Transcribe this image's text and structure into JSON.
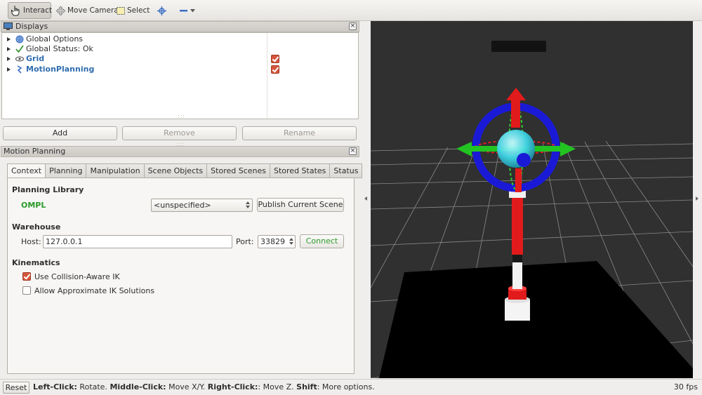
{
  "toolbar": {
    "interact": "Interact",
    "move_camera": "Move Camera",
    "select": "Select"
  },
  "displays": {
    "title": "Displays",
    "items": [
      {
        "label": "Global Options",
        "icon": "globe-icon",
        "checked": null
      },
      {
        "label": "Global Status: Ok",
        "icon": "checkmark-icon",
        "checked": null
      },
      {
        "label": "Grid",
        "icon": "grid-icon",
        "checked": true
      },
      {
        "label": "MotionPlanning",
        "icon": "motion-planning-icon",
        "checked": true
      }
    ],
    "buttons": {
      "add": "Add",
      "remove": "Remove",
      "rename": "Rename"
    }
  },
  "motion_planning": {
    "title": "Motion Planning",
    "tabs": [
      "Context",
      "Planning",
      "Manipulation",
      "Scene Objects",
      "Stored Scenes",
      "Stored States",
      "Status"
    ],
    "selected_tab": "Context",
    "planning_library": {
      "title": "Planning Library",
      "library": "OMPL",
      "planner": "<unspecified>",
      "publish_button": "Publish Current Scene"
    },
    "warehouse": {
      "title": "Warehouse",
      "host_label": "Host:",
      "host": "127.0.0.1",
      "port_label": "Port:",
      "port": "33829",
      "connect_button": "Connect"
    },
    "kinematics": {
      "title": "Kinematics",
      "collision_aware": "Use Collision-Aware IK",
      "collision_aware_checked": true,
      "approximate": "Allow Approximate IK Solutions",
      "approximate_checked": false
    }
  },
  "status": {
    "reset": "Reset",
    "left_click": "Left-Click:",
    "left_click_action": " Rotate. ",
    "middle_click": "Middle-Click:",
    "middle_click_action": " Move X/Y. ",
    "right_click": "Right-Click:",
    "right_click_action": ": Move Z. ",
    "shift": "Shift",
    "shift_action": ": More options.",
    "fps": "30 fps"
  },
  "colors": {
    "accent_green": "#2a9a2a",
    "link_blue": "#2f6db0",
    "checkbox_red": "#d5553c",
    "viewport_bg": "#303030"
  }
}
